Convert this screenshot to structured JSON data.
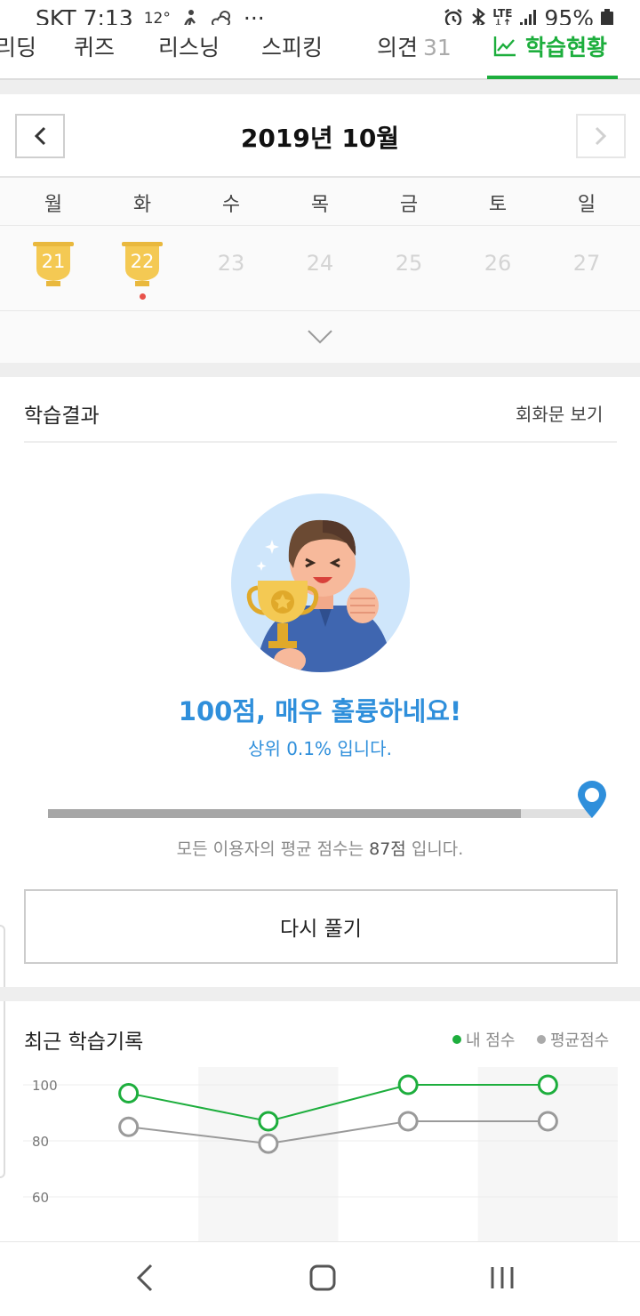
{
  "status_bar": {
    "carrier": "SKT",
    "time": "7:13",
    "temperature": "12°",
    "more": "···",
    "network": "LTE",
    "battery": "95%"
  },
  "tabs": [
    {
      "label": "리딩"
    },
    {
      "label": "퀴즈"
    },
    {
      "label": "리스닝"
    },
    {
      "label": "스피킹"
    },
    {
      "label": "의견",
      "count": "31"
    },
    {
      "label": "학습현황",
      "icon": "trend-chart-icon",
      "active": true
    }
  ],
  "calendar": {
    "month_title": "2019년 10월",
    "weekdays": [
      "월",
      "화",
      "수",
      "목",
      "금",
      "토",
      "일"
    ],
    "days": [
      {
        "day": "21",
        "completed": true,
        "marked": false
      },
      {
        "day": "22",
        "completed": true,
        "marked": true
      },
      {
        "day": "23",
        "completed": false,
        "marked": false
      },
      {
        "day": "24",
        "completed": false,
        "marked": false
      },
      {
        "day": "25",
        "completed": false,
        "marked": false
      },
      {
        "day": "26",
        "completed": false,
        "marked": false
      },
      {
        "day": "27",
        "completed": false,
        "marked": false
      }
    ]
  },
  "result": {
    "title": "학습결과",
    "dialogue_link": "회화문 보기",
    "score_message": "100점, 매우 훌륭하네요!",
    "rank_message": "상위 0.1% 입니다.",
    "my_score": 100,
    "average_score": 87,
    "avg_prefix": "모든 이용자의 평균 점수는 ",
    "avg_value": "87점",
    "avg_suffix": " 입니다.",
    "retry_label": "다시 풀기"
  },
  "history": {
    "title": "최근 학습기록",
    "legend_mine": "내 점수",
    "legend_avg": "평균점수"
  },
  "colors": {
    "accent": "#1dae3d",
    "score_blue": "#2f8fdb",
    "trophy_gold": "#f4c953",
    "avg_gray": "#9a9a9a"
  },
  "chart_data": {
    "type": "line",
    "yticks": [
      "100",
      "80",
      "60"
    ],
    "ylim": [
      55,
      100
    ],
    "grid": true,
    "x": [
      1,
      2,
      3,
      4
    ],
    "series": [
      {
        "name": "내 점수",
        "color": "#1dae3d",
        "values": [
          97,
          87,
          100,
          100
        ]
      },
      {
        "name": "평균점수",
        "color": "#9a9a9a",
        "values": [
          85,
          79,
          87,
          87
        ]
      }
    ]
  }
}
